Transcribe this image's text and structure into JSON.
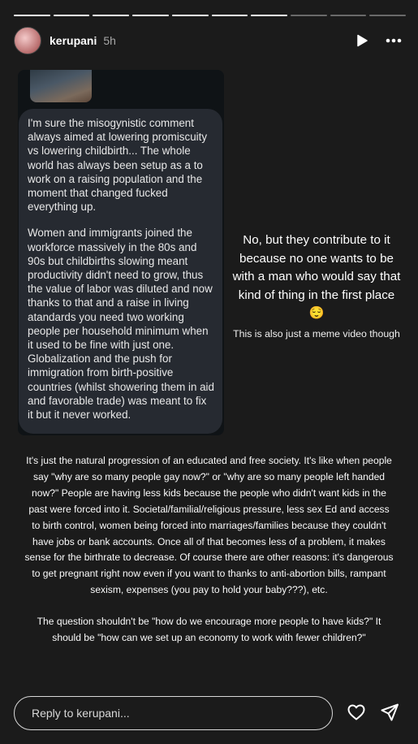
{
  "story": {
    "segments_total": 10,
    "segments_done": 7
  },
  "header": {
    "username": "kerupani",
    "time": "5h",
    "play_icon": "play-icon",
    "more_icon": "more-dots-icon"
  },
  "dm": {
    "paragraph1": "I'm sure the misogynistic comment always aimed at lowering promiscuity vs lowering childbirth... The whole world has always been setup as a to work on a raising population and the moment that changed fucked everything up.",
    "paragraph2": "Women and immigrants joined the workforce massively in the 80s and 90s but childbirths slowing meant productivity didn't need to grow, thus the value of labor was diluted and now thanks to that and a raise in living atandards you need two working people per household minimum when it used to be fine with just one. Globalization and the push for immigration from birth-positive countries (whilst showering them in aid and favorable trade) was meant to fix it but it never worked."
  },
  "caption": {
    "text": "No, but they contribute to it because no one wants to be with a man who would say that kind of thing in the first place 😌",
    "note": "This is also just a meme video though"
  },
  "body": {
    "paragraph1": "It's just the natural progression of an educated and free society. It's like when people say \"why are so many people gay now?\" or \"why are so many people left handed now?\" People are having less kids because the people who didn't want kids in the past were forced into it. Societal/familial/religious pressure, less sex Ed and access to birth control, women being forced into marriages/families because they couldn't have jobs or bank accounts. Once all of that becomes less of a problem, it makes sense for the birthrate to decrease. Of course there are other reasons: it's dangerous to get pregnant right now even if you want to thanks to anti-abortion bills, rampant sexism, expenses (you pay to hold your baby???), etc.",
    "paragraph2": "The question shouldn't be \"how do we encourage more people to have kids?\" It should be \"how can we set up an economy to work with fewer children?\""
  },
  "footer": {
    "reply_placeholder": "Reply to kerupani...",
    "like_icon": "heart-icon",
    "share_icon": "send-icon"
  }
}
